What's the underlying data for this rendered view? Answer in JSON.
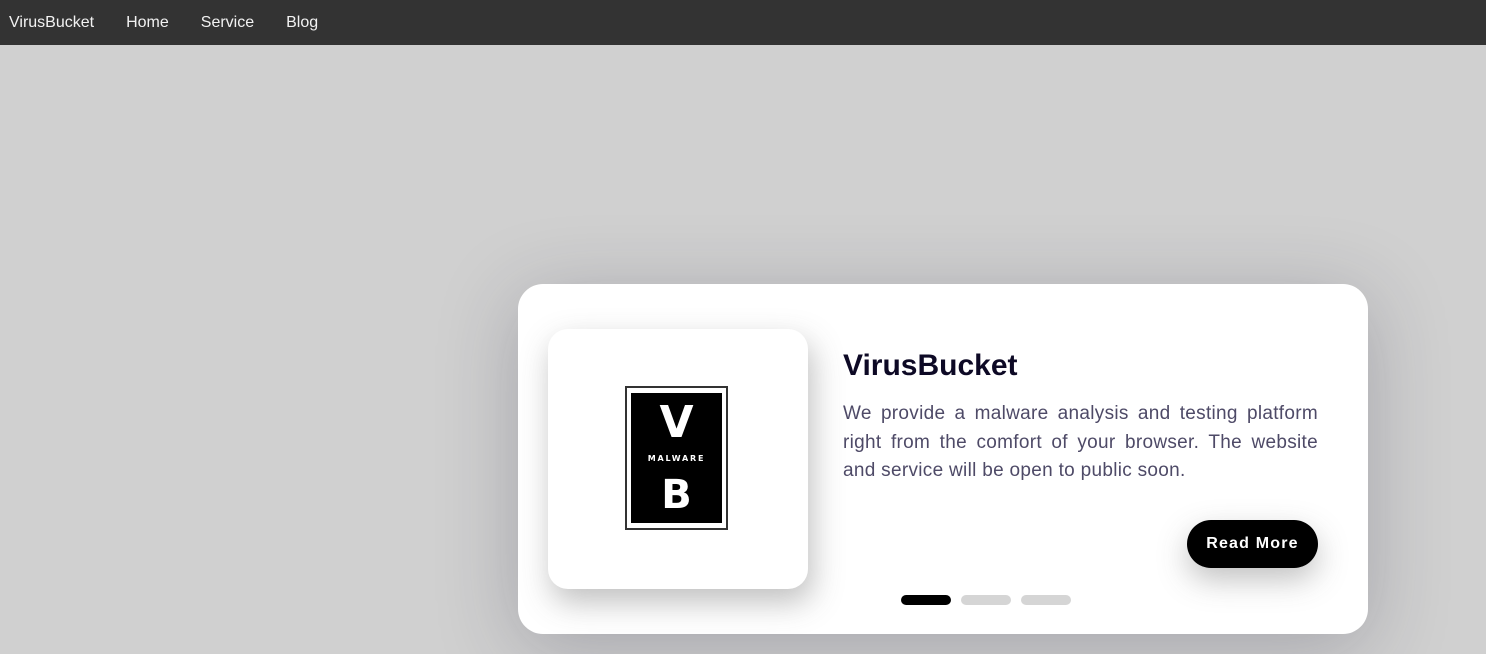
{
  "nav": {
    "brand": "VirusBucket",
    "links": [
      "Home",
      "Service",
      "Blog"
    ]
  },
  "card": {
    "logo": {
      "top_letter": "V",
      "word": "MALWARE",
      "bottom_letter": "B"
    },
    "title": "VirusBucket",
    "description": "We provide a malware analysis and testing platform right from the comfort of your browser. The website and service will be open to public soon.",
    "button_label": "Read More",
    "pagination": {
      "count": 3,
      "active_index": 0
    }
  },
  "colors": {
    "navbar_bg": "#333333",
    "page_bg": "#d0d0d0",
    "button_bg": "#000000",
    "title_color": "#0d0925",
    "text_color": "#4e4a67"
  }
}
